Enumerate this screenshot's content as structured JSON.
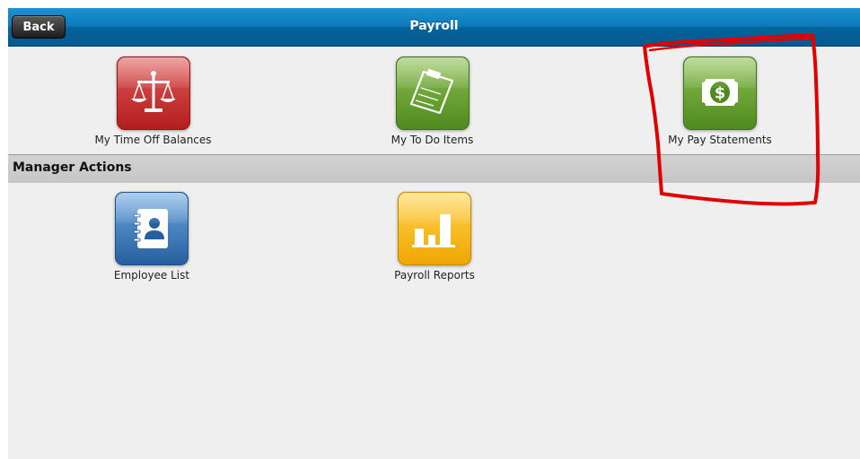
{
  "header": {
    "back_label": "Back",
    "title": "Payroll"
  },
  "tiles": [
    {
      "label": "My Time Off Balances",
      "icon": "scales-icon",
      "color": "#c62a2a"
    },
    {
      "label": "My To Do Items",
      "icon": "clipboard-icon",
      "color": "#6aa23a"
    },
    {
      "label": "My Pay Statements",
      "icon": "dollar-bill-icon",
      "color": "#6aa23a"
    }
  ],
  "manager_section": {
    "title": "Manager Actions",
    "tiles": [
      {
        "label": "Employee List",
        "icon": "address-book-icon",
        "color": "#3b7cc4"
      },
      {
        "label": "Payroll Reports",
        "icon": "bar-chart-icon",
        "color": "#f5b800"
      }
    ]
  },
  "annotation": {
    "type": "hand-drawn-outline",
    "color": "#e00000"
  }
}
